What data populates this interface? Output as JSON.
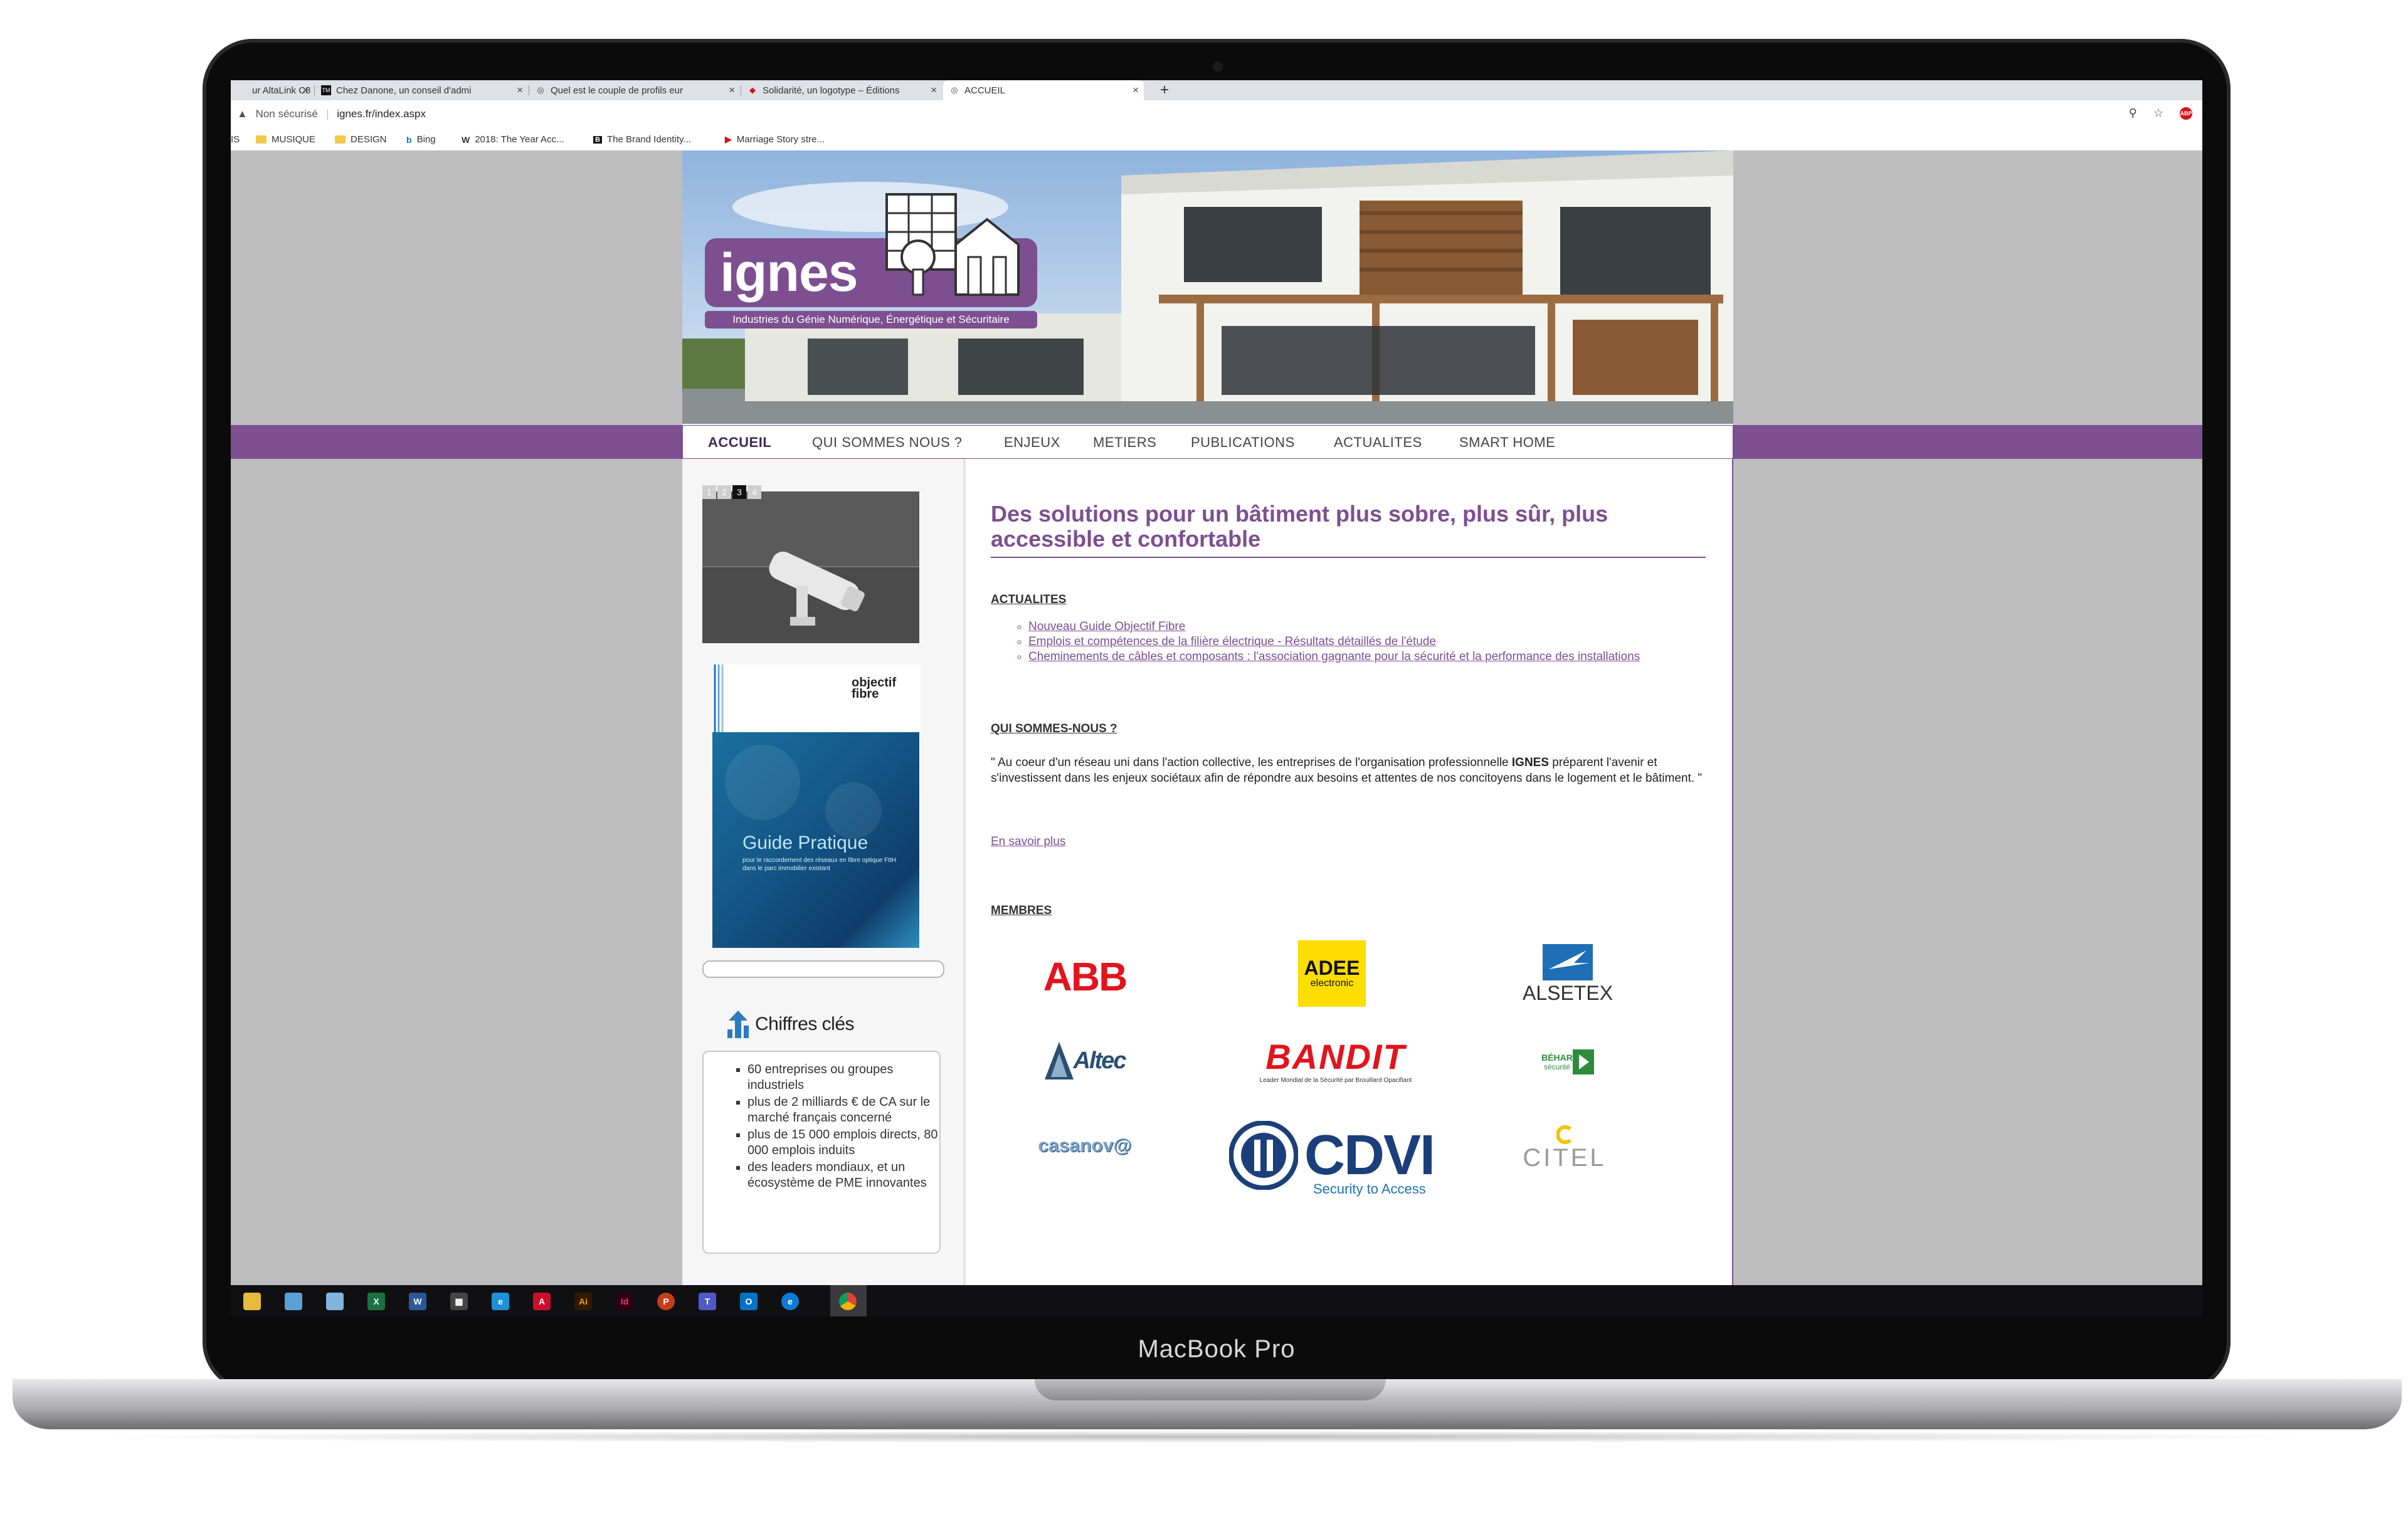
{
  "device": {
    "model_label": "MacBook Pro"
  },
  "browser": {
    "tabs": [
      {
        "title": "ur AltaLink C8",
        "icon": "document-icon"
      },
      {
        "title": "Chez Danone, un conseil d'admi",
        "icon": "tm-icon"
      },
      {
        "title": "Quel est le couple de profils eur",
        "icon": "globe-icon"
      },
      {
        "title": "Solidarité, un logotype – Éditions",
        "icon": "pin-icon"
      },
      {
        "title": "ACCUEIL",
        "icon": "globe-icon",
        "active": true
      }
    ],
    "new_tab": "+",
    "security": "Non sécurisé",
    "url": "ignes.fr/index.aspx",
    "bookmarks": [
      {
        "label": "IS",
        "type": "text"
      },
      {
        "label": "MUSIQUE",
        "type": "folder"
      },
      {
        "label": "DESIGN",
        "type": "folder"
      },
      {
        "label": "Bing",
        "type": "bing"
      },
      {
        "label": "2018: The Year Acc...",
        "type": "w"
      },
      {
        "label": "The Brand Identity...",
        "type": "b"
      },
      {
        "label": "Marriage Story stre...",
        "type": "play"
      }
    ]
  },
  "site": {
    "logo_text": "ignes",
    "logo_tagline": "Industries du Génie Numérique, Énergétique et Sécuritaire",
    "nav": [
      "ACCUEIL",
      "QUI SOMMES NOUS ?",
      "ENJEUX",
      "METIERS",
      "PUBLICATIONS",
      "ACTUALITES",
      "SMART HOME"
    ],
    "slider_pages": [
      "1",
      "2",
      "3",
      "4"
    ],
    "slider_active": 3,
    "guide": {
      "logo_line1": "objectif",
      "logo_line2": "fibre",
      "title": "Guide Pratique",
      "subtitle": "pour le raccordement des réseaux en fibre optique FttH dans le parc immobilier existant"
    },
    "chiffres_title": "Chiffres clés",
    "chiffres": [
      "60 entreprises ou groupes industriels",
      "plus de 2 milliards € de CA sur le marché français concerné",
      "plus de 15 000 emplois directs, 80 000 emplois induits",
      "des leaders mondiaux, et un écosystème de PME innovantes"
    ],
    "headline": "Des solutions pour un bâtiment plus sobre, plus sûr, plus accessible et confortable",
    "actualites_title": "ACTUALITES",
    "actualites": [
      "Nouveau Guide Objectif Fibre",
      "Emplois et compétences de la filière électrique - Résultats détaillés de l'étude",
      "Cheminements de câbles et composants : l'association gagnante pour la sécurité et la performance des installations"
    ],
    "qui_title": "QUI SOMMES-NOUS ?",
    "quote_before": "\" Au coeur d'un réseau uni dans l'action collective, les entreprises de l'organisation professionnelle ",
    "quote_bold": "IGNES",
    "quote_after": " préparent l'avenir et s'investissent dans les enjeux sociétaux afin de répondre aux besoins et attentes de nos concitoyens dans le logement et le bâtiment. \"",
    "more_link": "En savoir plus",
    "membres_title": "MEMBRES",
    "members": {
      "abb": "ABB",
      "adee_1": "ADEE",
      "adee_2": "electronic",
      "alsetex": "ALSETEX",
      "altec": "Altec",
      "bandit": "BANDIT",
      "bandit_sub": "Leader Mondial de la Sécurité par Brouillard Opacifiant",
      "behar_1": "BÉHAR",
      "behar_2": "sécurité",
      "casanova": "casanov@",
      "cdvi": "CDVI",
      "cdvi_sub": "Security to Access",
      "citel": "CITEL"
    }
  },
  "colors": {
    "brand_purple": "#7d4f91",
    "page_gray": "#bdbdbd"
  },
  "taskbar": [
    "file-explorer-icon",
    "paint-icon",
    "notepad-icon",
    "excel-icon",
    "word-icon",
    "calculator-icon",
    "ie-icon",
    "acrobat-icon",
    "illustrator-icon",
    "indesign-icon",
    "powerpoint-icon",
    "teams-icon",
    "outlook-icon",
    "edge-icon",
    "chrome-icon"
  ]
}
